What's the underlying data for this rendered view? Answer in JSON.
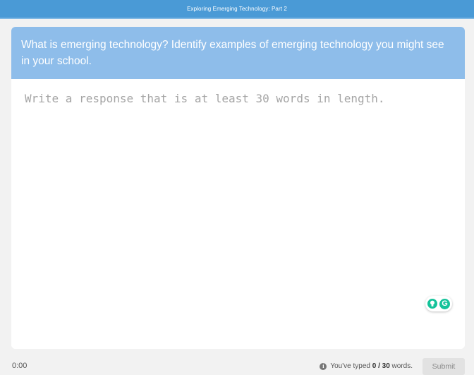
{
  "header": {
    "title": "Exploring Emerging Technology: Part 2"
  },
  "prompt": {
    "text": "What is emerging technology? Identify examples of emerging technology you might see in your school."
  },
  "response": {
    "value": "",
    "placeholder": "Write a response that is at least 30 words in length."
  },
  "grammarly": {
    "icon": "grammarly-icon",
    "logo_letter": "G",
    "color": "#15c39a"
  },
  "footer": {
    "timer": "0:00",
    "word_status_prefix": "You've typed ",
    "words_typed": "0",
    "separator": " / ",
    "words_required": "30",
    "word_status_suffix": " words.",
    "submit_label": "Submit"
  },
  "colors": {
    "header_bg": "#4a9ad6",
    "prompt_bg": "#8ebdea",
    "submit_bg": "#e2e2e2"
  }
}
